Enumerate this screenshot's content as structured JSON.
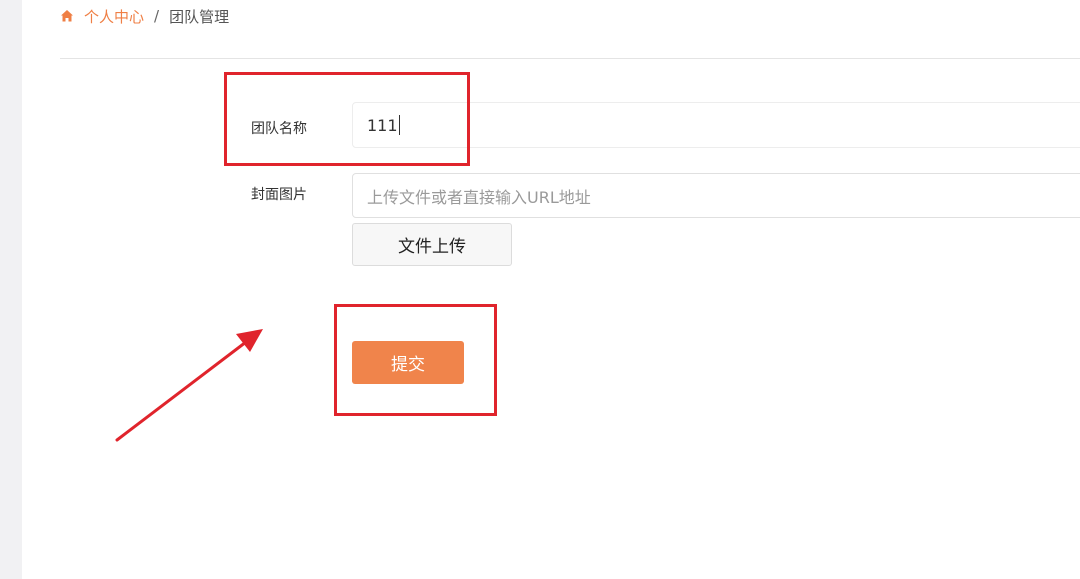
{
  "breadcrumb": {
    "home_icon": "home-icon",
    "parent": "个人中心",
    "separator": "/",
    "current": "团队管理"
  },
  "form": {
    "team_name": {
      "label": "团队名称",
      "value": "111"
    },
    "cover_image": {
      "label": "封面图片",
      "placeholder": "上传文件或者直接输入URL地址",
      "upload_label": "文件上传"
    },
    "submit_label": "提交"
  },
  "colors": {
    "accent": "#f0844b",
    "breadcrumb_link": "#ef7f45",
    "annotation_red": "#e0242c"
  }
}
